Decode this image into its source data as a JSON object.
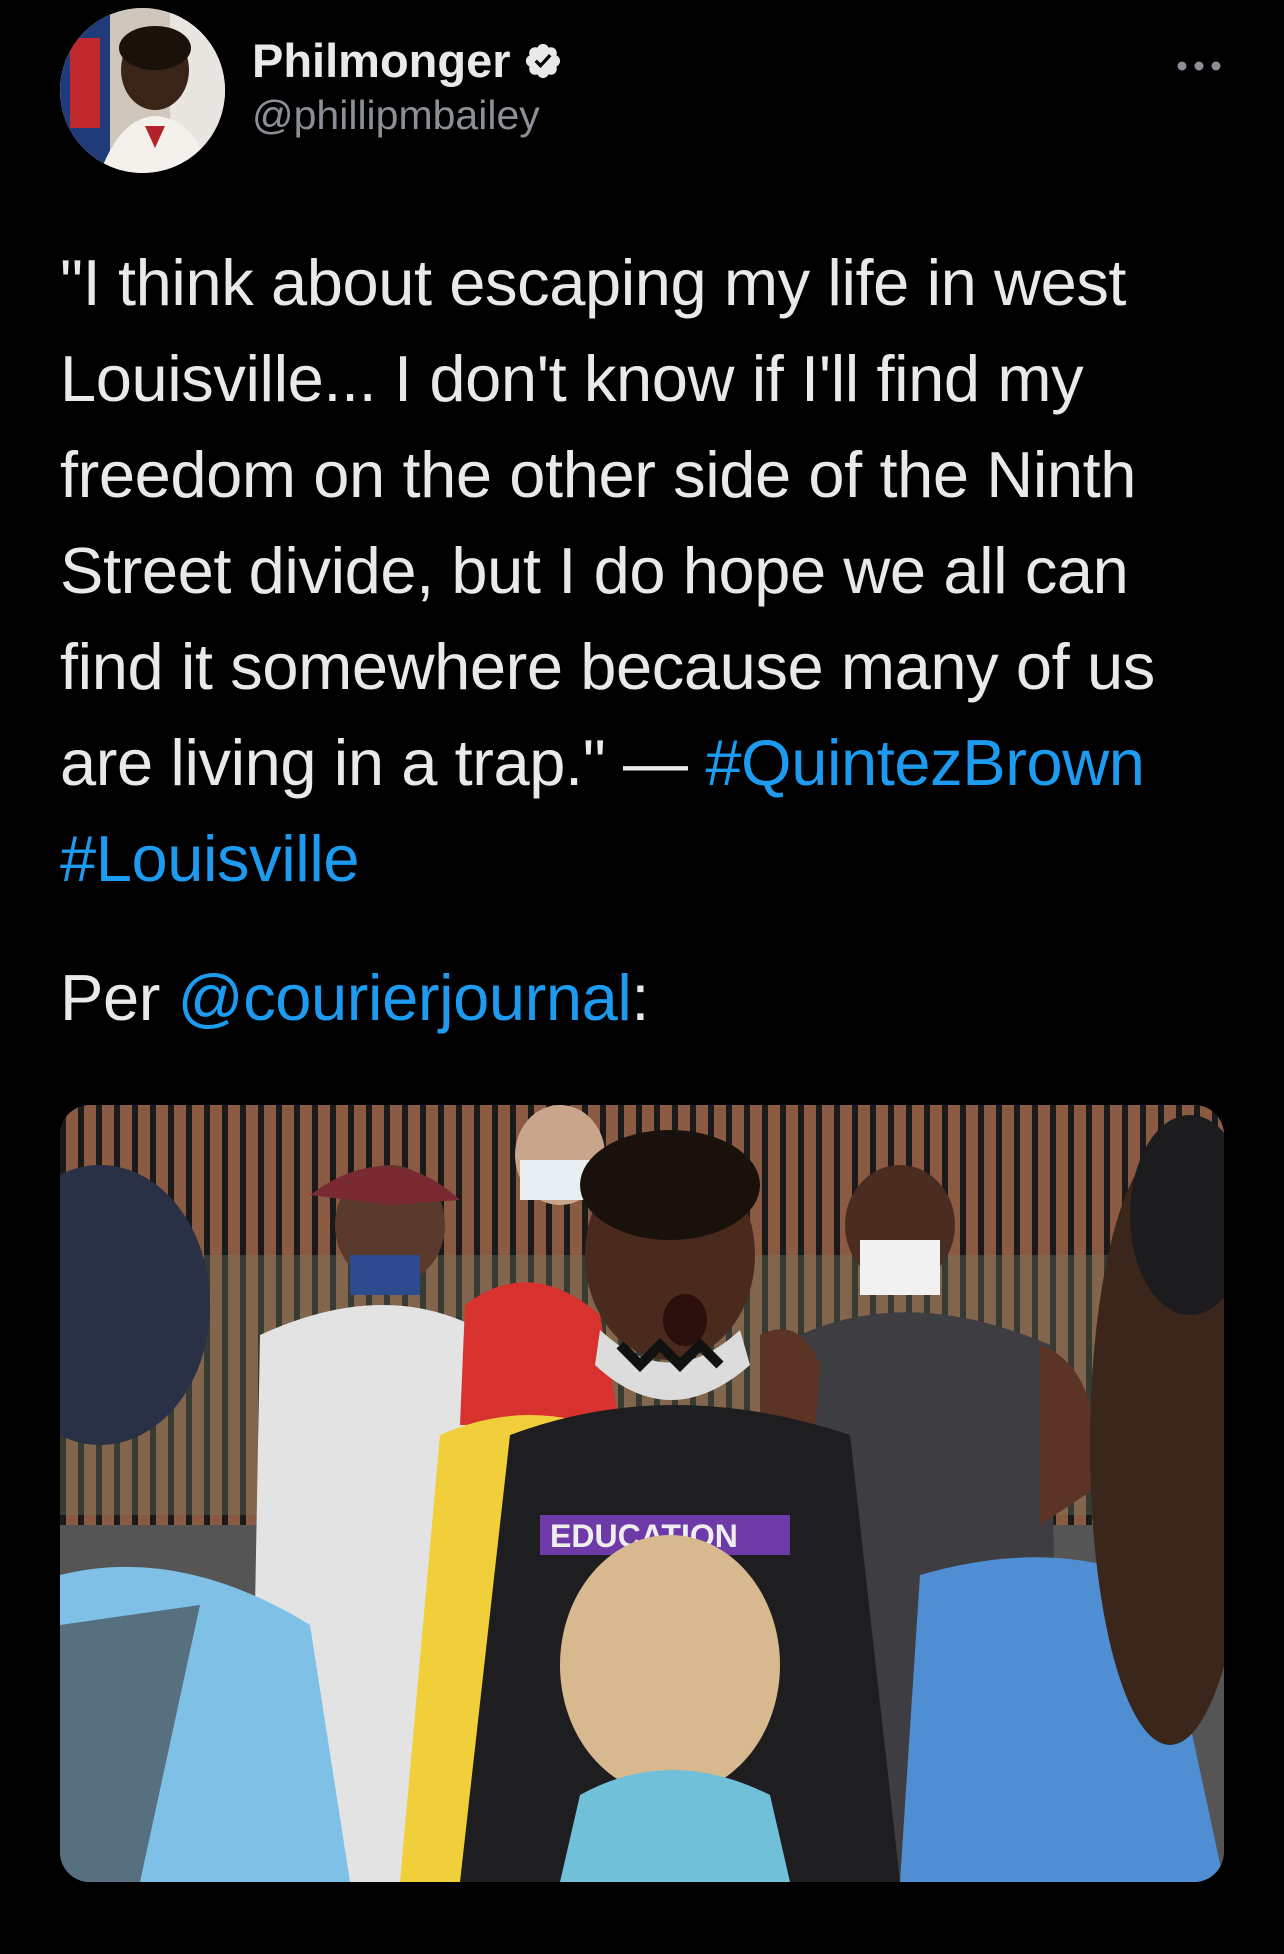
{
  "author": {
    "display_name": "Philmonger",
    "handle": "@phillipmbailey",
    "verified": true,
    "verified_icon": "verified-badge-icon",
    "avatar_icon": "avatar"
  },
  "more_icon": "more-icon",
  "tweet": {
    "quote": "\"I think about escaping my life in west Louisville... I don't know if I'll find my freedom on the other side of the Ninth Street divide, but I do hope we all can find it somewhere because many of us are living in a trap.\" — ",
    "hashtag_1": "#QuintezBrown",
    "hashtag_2": "#Louisville",
    "per_prefix": "Per ",
    "mention": "@courierjournal",
    "per_suffix": ":"
  },
  "media": {
    "shirt_text": "EDUCATION"
  },
  "colors": {
    "background": "#000000",
    "text": "#e7e9ea",
    "secondary": "#8b9096",
    "link": "#1d9bf0"
  }
}
